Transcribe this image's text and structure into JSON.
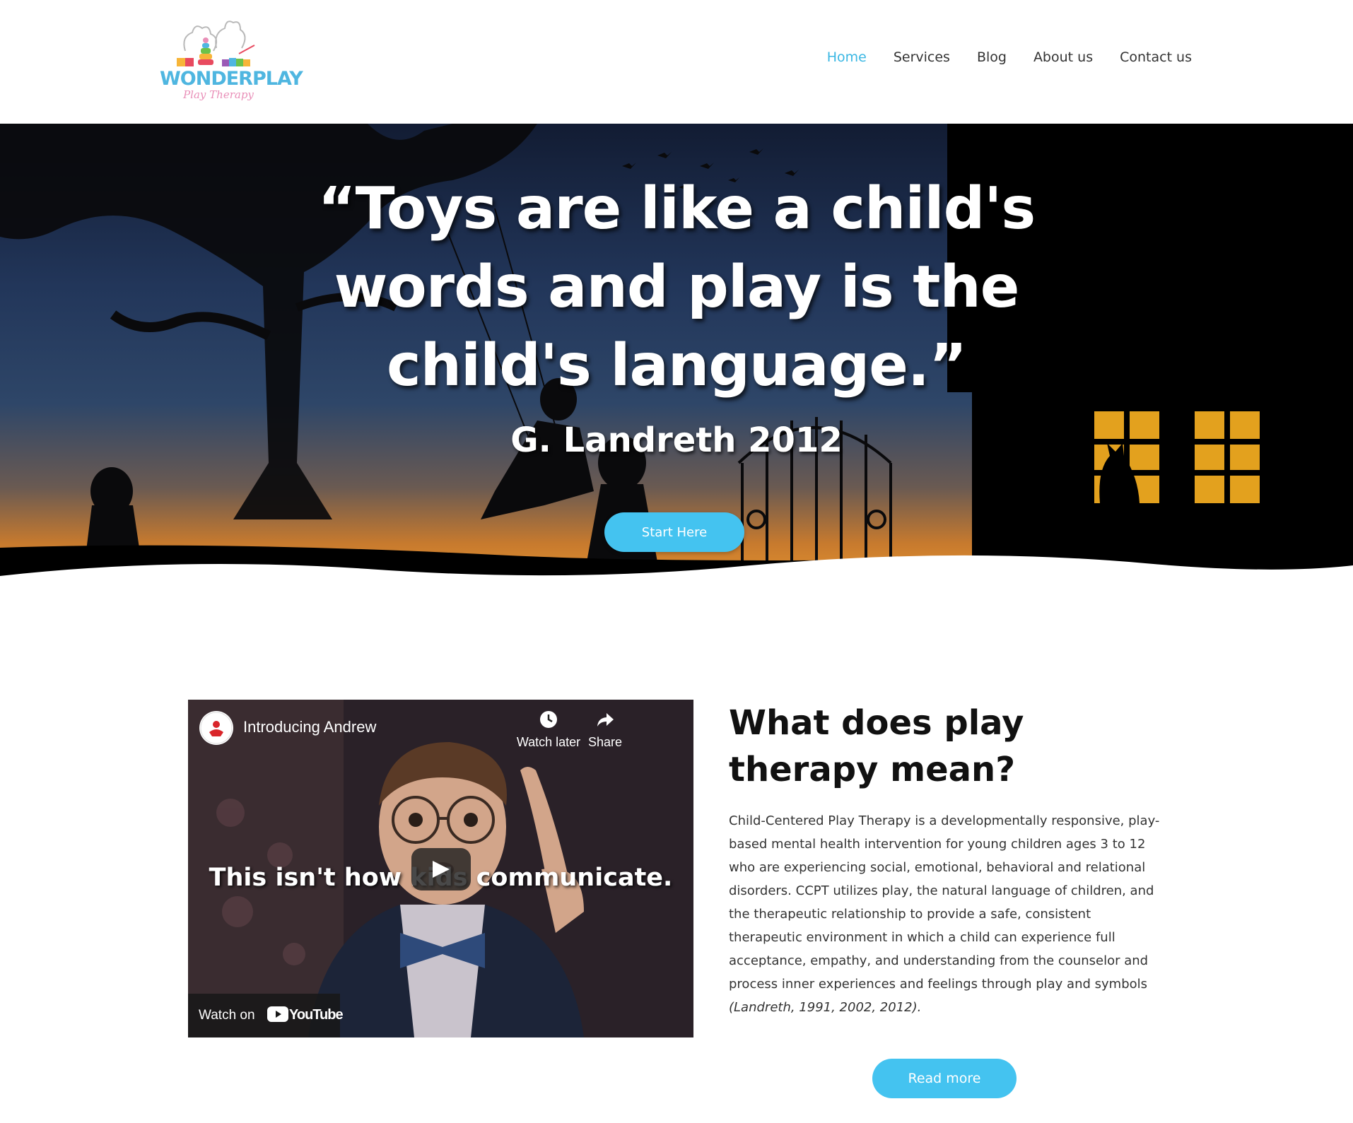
{
  "header": {
    "logo": {
      "word": "WONDERPLAY",
      "sub": "Play Therapy"
    },
    "nav": [
      {
        "label": "Home",
        "active": true
      },
      {
        "label": "Services",
        "active": false
      },
      {
        "label": "Blog",
        "active": false
      },
      {
        "label": "About us",
        "active": false
      },
      {
        "label": "Contact us",
        "active": false
      }
    ]
  },
  "hero": {
    "quote": "“Toys are like a child's words and play is the child's language.”",
    "author": "G. Landreth 2012",
    "button_label": "Start Here"
  },
  "video": {
    "title": "Introducing Andrew",
    "watch_later": "Watch later",
    "share": "Share",
    "caption": "This isn't how kids communicate.",
    "watch_on": "Watch on",
    "youtube": "YouTube"
  },
  "info": {
    "title": "What does play therapy mean?",
    "body": "Child-Centered Play Therapy is a developmentally responsive, play-based mental health intervention for young children ages 3 to 12 who are experiencing social, emotional, behavioral and relational disorders. CCPT utilizes play, the natural language of children, and the therapeutic relationship to provide a safe, consistent therapeutic environment in which a child can experience full acceptance, empathy, and understanding from the counselor and process inner experiences and feelings through play and symbols",
    "citation": "(Landreth, 1991, 2002, 2012).",
    "read_more": "Read more"
  },
  "colors": {
    "accent": "#44c3f0",
    "nav_active": "#3ab7e3",
    "logo_blue": "#4fb6e0",
    "logo_pink": "#e98fb8"
  }
}
